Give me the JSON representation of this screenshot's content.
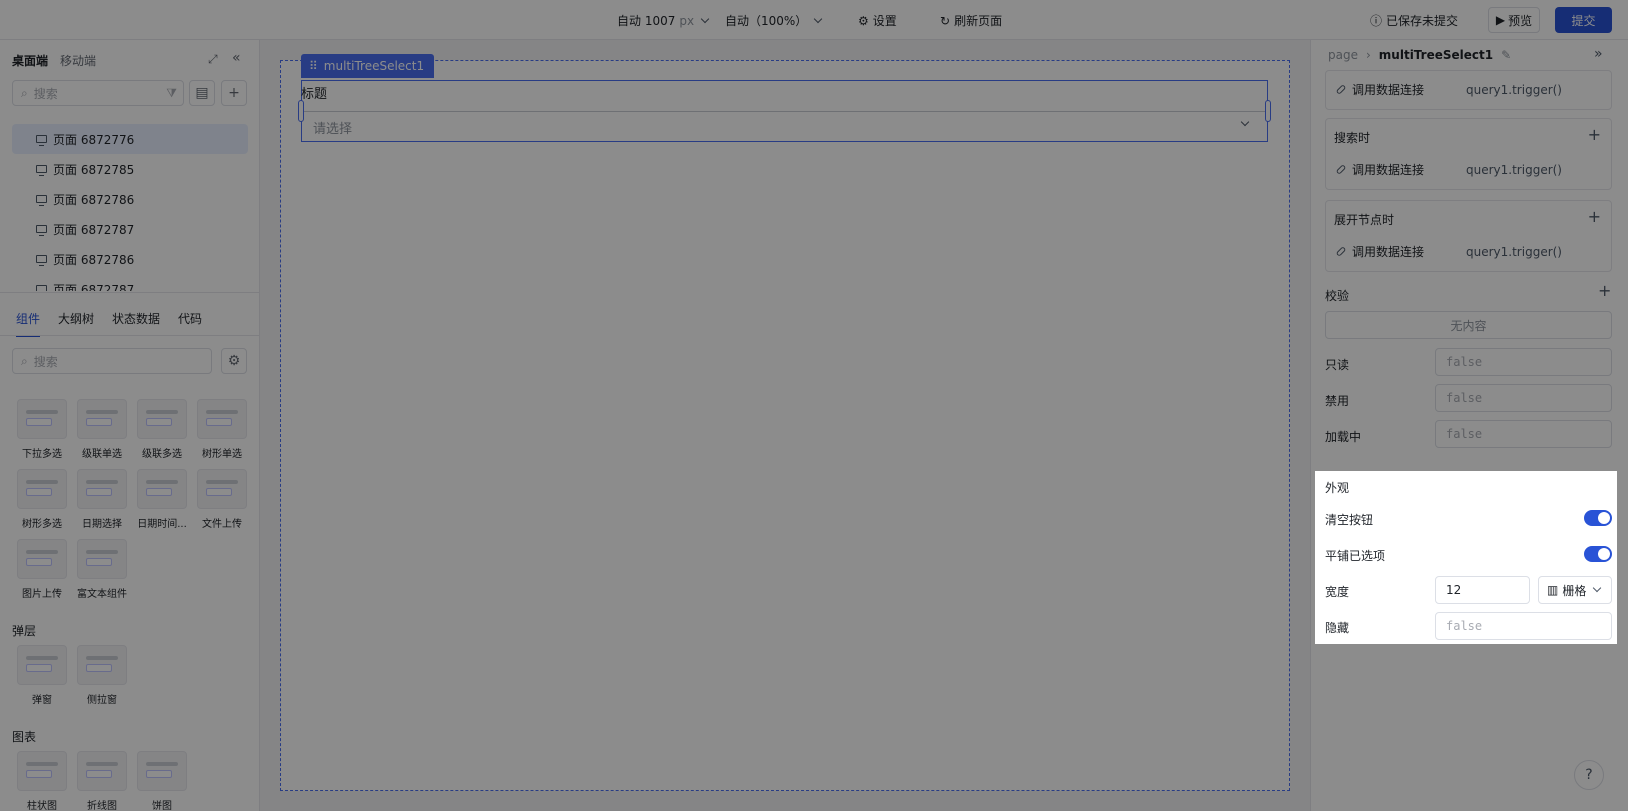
{
  "topbar": {
    "width_value": "自动 1007",
    "width_unit": "px",
    "zoom": "自动（100%）",
    "settings": "设置",
    "refresh": "刷新页面",
    "save_status": "已保存未提交",
    "preview": "预览",
    "submit": "提交"
  },
  "left": {
    "tabs": [
      "桌面端",
      "移动端"
    ],
    "search_placeholder": "搜索",
    "pages": [
      "页面 6872776",
      "页面 6872785",
      "页面 6872786",
      "页面 6872787",
      "页面 6872786",
      "页面 6872787"
    ],
    "panel_tabs": [
      "组件",
      "大纲树",
      "状态数据",
      "代码"
    ],
    "comp_search_placeholder": "搜索",
    "components": [
      "下拉多选",
      "级联单选",
      "级联多选",
      "树形单选",
      "树形多选",
      "日期选择",
      "日期时间...",
      "文件上传",
      "图片上传",
      "富文本组件"
    ],
    "section_popup": "弹层",
    "popup_components": [
      "弹窗",
      "侧拉窗"
    ],
    "section_chart": "图表",
    "chart_components": [
      "柱状图",
      "折线图",
      "饼图"
    ]
  },
  "canvas": {
    "widget_name": "multiTreeSelect1",
    "title": "标题",
    "placeholder": "请选择"
  },
  "right": {
    "breadcrumb_root": "page",
    "breadcrumb_current": "multiTreeSelect1",
    "events": [
      {
        "title": "",
        "action": "调用数据连接",
        "query": "query1.trigger()"
      },
      {
        "title": "搜索时",
        "action": "调用数据连接",
        "query": "query1.trigger()"
      },
      {
        "title": "展开节点时",
        "action": "调用数据连接",
        "query": "query1.trigger()"
      }
    ],
    "validation": "校验",
    "empty": "无内容",
    "props": [
      {
        "label": "只读",
        "value": "false"
      },
      {
        "label": "禁用",
        "value": "false"
      },
      {
        "label": "加载中",
        "value": "false"
      }
    ],
    "appearance": {
      "title": "外观",
      "clear_button": "清空按钮",
      "tile_selected": "平铺已选项",
      "width_label": "宽度",
      "width_value": "12",
      "grid_label": "栅格",
      "hidden_label": "隐藏",
      "hidden_value": "false"
    }
  }
}
